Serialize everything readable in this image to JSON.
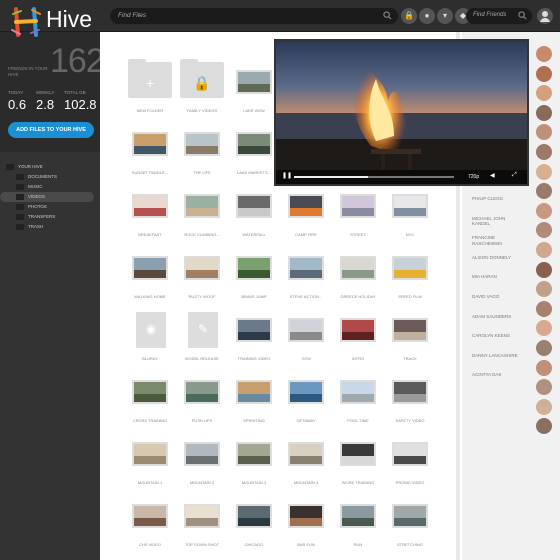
{
  "app": {
    "name": "Hive",
    "accent": "#1a8fd4"
  },
  "search": {
    "placeholder": "Find Files"
  },
  "friend_search": {
    "placeholder": "Find Friends"
  },
  "header_buttons": [
    {
      "icon": "lock-icon",
      "glyph": "🔒"
    },
    {
      "icon": "eye-icon",
      "glyph": "●"
    },
    {
      "icon": "chevron-down-icon",
      "glyph": "▾"
    },
    {
      "icon": "bell-icon",
      "glyph": "◆"
    }
  ],
  "sidebar": {
    "friends_count": "162",
    "friends_label": "FRIENDS IN YOUR HIVE",
    "stats": [
      {
        "label": "TODAY",
        "value": "0.6"
      },
      {
        "label": "WEEKLY",
        "value": "2.8"
      },
      {
        "label": "TOTAL GB",
        "value": "102.8"
      }
    ],
    "add_button": "ADD FILES TO YOUR HIVE",
    "tree": [
      {
        "label": "YOUR HIVE",
        "level": 0,
        "selected": false
      },
      {
        "label": "DOCUMENTS",
        "level": 1,
        "selected": false
      },
      {
        "label": "MUSIC",
        "level": 1,
        "selected": false
      },
      {
        "label": "VIDEOS",
        "level": 1,
        "selected": true
      },
      {
        "label": "PHOTOS",
        "level": 1,
        "selected": false
      },
      {
        "label": "TRANSFERS",
        "level": 1,
        "selected": false
      },
      {
        "label": "TRASH",
        "level": 1,
        "selected": false
      }
    ]
  },
  "files": [
    {
      "label": "NEW FOLDER",
      "kind": "folder",
      "glyph": "+"
    },
    {
      "label": "FAMILY VIDEOS",
      "kind": "folder",
      "glyph": "🔒"
    },
    {
      "label": "LAKE VIEW",
      "kind": "thumb",
      "color": "#9aa8b0",
      "color2": "#5f6a55"
    },
    {
      "label": "",
      "kind": "hidden"
    },
    {
      "label": "",
      "kind": "hidden"
    },
    {
      "label": "",
      "kind": "hidden"
    },
    {
      "label": "SUNSET PADDLE...",
      "kind": "thumb",
      "color": "#c9a06a",
      "color2": "#445566"
    },
    {
      "label": "THE LIFE",
      "kind": "thumb",
      "color": "#b8c4c8",
      "color2": "#8a7a6a"
    },
    {
      "label": "LAKE MARKETS...",
      "kind": "thumb",
      "color": "#7c8a7a",
      "color2": "#3a4a3a"
    },
    {
      "label": "",
      "kind": "hidden"
    },
    {
      "label": "",
      "kind": "hidden"
    },
    {
      "label": "",
      "kind": "hidden"
    },
    {
      "label": "BREAKFAST",
      "kind": "thumb",
      "color": "#e8d8d0",
      "color2": "#b85050"
    },
    {
      "label": "ROCK CLIMBING...",
      "kind": "thumb",
      "color": "#9ab0a0",
      "color2": "#c8b090"
    },
    {
      "label": "WATERFALL",
      "kind": "thumb",
      "color": "#6a6a6a",
      "color2": "#c8c8c8"
    },
    {
      "label": "CAMP FIRE",
      "kind": "thumb",
      "color": "#4a4a55",
      "color2": "#e07a30"
    },
    {
      "label": "STREET",
      "kind": "thumb",
      "color": "#d0c8d8",
      "color2": "#8a8aa0"
    },
    {
      "label": "NYC",
      "kind": "thumb",
      "color": "#e8e8ea",
      "color2": "#8090a0"
    },
    {
      "label": "WALKING HOME",
      "kind": "thumb",
      "color": "#8aa0b0",
      "color2": "#5a4a3a"
    },
    {
      "label": "RUSTY WOOF",
      "kind": "thumb",
      "color": "#e0d8c8",
      "color2": "#a08060"
    },
    {
      "label": "BRAVE JUMP",
      "kind": "thumb",
      "color": "#7aa070",
      "color2": "#3a5a30"
    },
    {
      "label": "STEVE ACTION...",
      "kind": "thumb",
      "color": "#a0b8c8",
      "color2": "#5a6a7a"
    },
    {
      "label": "GREECE HOLIDAY",
      "kind": "thumb",
      "color": "#d8d8d0",
      "color2": "#8a9a8a"
    },
    {
      "label": "SPEED FILM",
      "kind": "thumb",
      "color": "#c8d0d8",
      "color2": "#e8b030"
    },
    {
      "label": "BLURAY",
      "kind": "doc",
      "glyph": "◉"
    },
    {
      "label": "MODEL RELEASE",
      "kind": "doc",
      "glyph": "✎"
    },
    {
      "label": "TRAINING VIDEO",
      "kind": "thumb",
      "color": "#6a7a8a",
      "color2": "#2a3a4a"
    },
    {
      "label": "GYM",
      "kind": "thumb",
      "color": "#d0d4d8",
      "color2": "#8a8a8a"
    },
    {
      "label": "INTRO",
      "kind": "thumb",
      "color": "#b04a4a",
      "color2": "#602020"
    },
    {
      "label": "TRACK",
      "kind": "thumb",
      "color": "#6a5a5a",
      "color2": "#c0b0a0"
    },
    {
      "label": "CROSS TRAINING",
      "kind": "thumb",
      "color": "#7a8a6a",
      "color2": "#4a5a3a"
    },
    {
      "label": "PUSH UPS",
      "kind": "thumb",
      "color": "#8a9a8a",
      "color2": "#4a6a5a"
    },
    {
      "label": "SPRINTING",
      "kind": "thumb",
      "color": "#c8a070",
      "color2": "#6a8aa0"
    },
    {
      "label": "GETAWAY",
      "kind": "thumb",
      "color": "#6a98c0",
      "color2": "#2a5a80"
    },
    {
      "label": "POOL TIME",
      "kind": "thumb",
      "color": "#c8d8e8",
      "color2": "#a0a8b0"
    },
    {
      "label": "SAFETY VIDEO",
      "kind": "thumb",
      "color": "#5a5a5a",
      "color2": "#9a9a9a"
    },
    {
      "label": "MOUNTAIN 1",
      "kind": "thumb",
      "color": "#d8c8b0",
      "color2": "#9a8a70"
    },
    {
      "label": "MOUNTAIN 2",
      "kind": "thumb",
      "color": "#b0b8c0",
      "color2": "#6a7070"
    },
    {
      "label": "MOUNTAIN 3",
      "kind": "thumb",
      "color": "#a0a890",
      "color2": "#5a6050"
    },
    {
      "label": "MOUNTAIN 4",
      "kind": "thumb",
      "color": "#d8d0c0",
      "color2": "#8a8070"
    },
    {
      "label": "WORK TRAINING",
      "kind": "thumb",
      "color": "#3a3a3a",
      "color2": "#d8d8d8"
    },
    {
      "label": "PROMO VIDEO",
      "kind": "thumb",
      "color": "#e0e0e0",
      "color2": "#4a4a4a"
    },
    {
      "label": "CHS VIDEO",
      "kind": "thumb",
      "color": "#c8b8a8",
      "color2": "#7a5a4a"
    },
    {
      "label": "TOP DOWN SHOT",
      "kind": "thumb",
      "color": "#e8e0d0",
      "color2": "#a09080"
    },
    {
      "label": "CHICAGO",
      "kind": "thumb",
      "color": "#5a6a70",
      "color2": "#2a3a40"
    },
    {
      "label": "BAR FUN",
      "kind": "thumb",
      "color": "#3a3030",
      "color2": "#a07050"
    },
    {
      "label": "RUN",
      "kind": "thumb",
      "color": "#8a9aa0",
      "color2": "#4a5a50"
    },
    {
      "label": "STRETCHING",
      "kind": "thumb",
      "color": "#a0a8a8",
      "color2": "#5a6a6a"
    }
  ],
  "friends": [
    {
      "name": "PHILIP CLEGG"
    },
    {
      "name": "MICHAEL JOHN KANDEL"
    },
    {
      "name": "FRANCINE RASCHEWSKI"
    },
    {
      "name": "ALISON DONNELY"
    },
    {
      "name": "MIA HARAN"
    },
    {
      "name": "DAVID VAGO"
    },
    {
      "name": "ADAM SAUNDERS"
    },
    {
      "name": "CAROLYN KEENS"
    },
    {
      "name": "DANNY LANCASHIRE"
    },
    {
      "name": "ACINTYA DAS"
    }
  ],
  "friend_avatars": [
    "#c98a6a",
    "#b07050",
    "#d4a080",
    "#8a6a5a",
    "#c0907a",
    "#a07868",
    "#d8b090",
    "#9a7a6a",
    "#c89880",
    "#b08a7a",
    "#d0a890",
    "#8a6050",
    "#c0a088",
    "#a88070",
    "#d8a890",
    "#9a8070",
    "#c09078",
    "#b09080",
    "#d0b098",
    "#8a7060"
  ],
  "player": {
    "quality": "720p",
    "progress": 0.46
  }
}
